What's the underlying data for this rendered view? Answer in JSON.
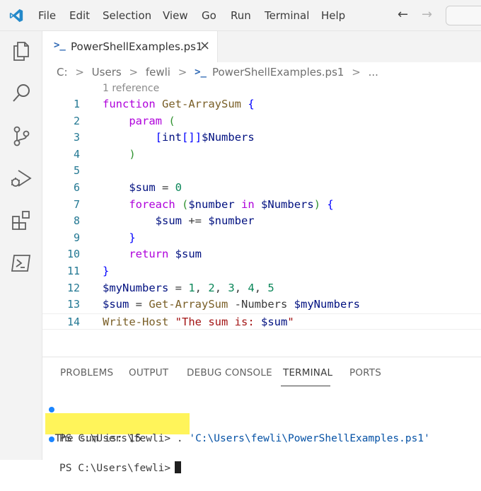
{
  "menu": {
    "items": [
      "File",
      "Edit",
      "Selection",
      "View",
      "Go",
      "Run",
      "Terminal",
      "Help"
    ]
  },
  "nav": {
    "back_icon": "arrow-left-icon",
    "forward_icon": "arrow-right-icon"
  },
  "activity_bar": {
    "icons": [
      "explorer-icon",
      "search-icon",
      "source-control-icon",
      "run-debug-icon",
      "extensions-icon",
      "powershell-icon"
    ]
  },
  "tab": {
    "label": "PowerShellExamples.ps1",
    "close": "×",
    "icon": ">_"
  },
  "breadcrumb": {
    "parts": [
      "C:",
      "Users",
      "fewli",
      "PowerShellExamples.ps1",
      "..."
    ],
    "separator": ">"
  },
  "editor": {
    "codelens": "1 reference",
    "lines": [
      {
        "num": "1",
        "text": "function Get-ArraySum {"
      },
      {
        "num": "2",
        "text": "    param ("
      },
      {
        "num": "3",
        "text": "        [int[]]$Numbers"
      },
      {
        "num": "4",
        "text": "    )"
      },
      {
        "num": "5",
        "text": ""
      },
      {
        "num": "6",
        "text": "    $sum = 0"
      },
      {
        "num": "7",
        "text": "    foreach ($number in $Numbers) {"
      },
      {
        "num": "8",
        "text": "        $sum += $number"
      },
      {
        "num": "9",
        "text": "    }"
      },
      {
        "num": "10",
        "text": "    return $sum"
      },
      {
        "num": "11",
        "text": "}"
      },
      {
        "num": "12",
        "text": "$myNumbers = 1, 2, 3, 4, 5"
      },
      {
        "num": "13",
        "text": "$sum = Get-ArraySum -Numbers $myNumbers"
      },
      {
        "num": "14",
        "text": "Write-Host \"The sum is: $sum\""
      }
    ]
  },
  "panel": {
    "tabs": [
      "PROBLEMS",
      "OUTPUT",
      "DEBUG CONSOLE",
      "TERMINAL",
      "PORTS"
    ],
    "active_tab": "TERMINAL"
  },
  "terminal": {
    "line1_prompt": "PS C:\\Users\\fewli> ",
    "line1_cmd": ". ",
    "line1_path": "'C:\\Users\\fewli\\PowerShellExamples.ps1'",
    "line2_output": "  The sum is: 15",
    "line3_prompt": "PS C:\\Users\\fewli>"
  },
  "colors": {
    "accent": "#1a85ff",
    "highlight": "#fff45a",
    "keyword": "#af00db",
    "string": "#a31515",
    "number": "#098658"
  }
}
